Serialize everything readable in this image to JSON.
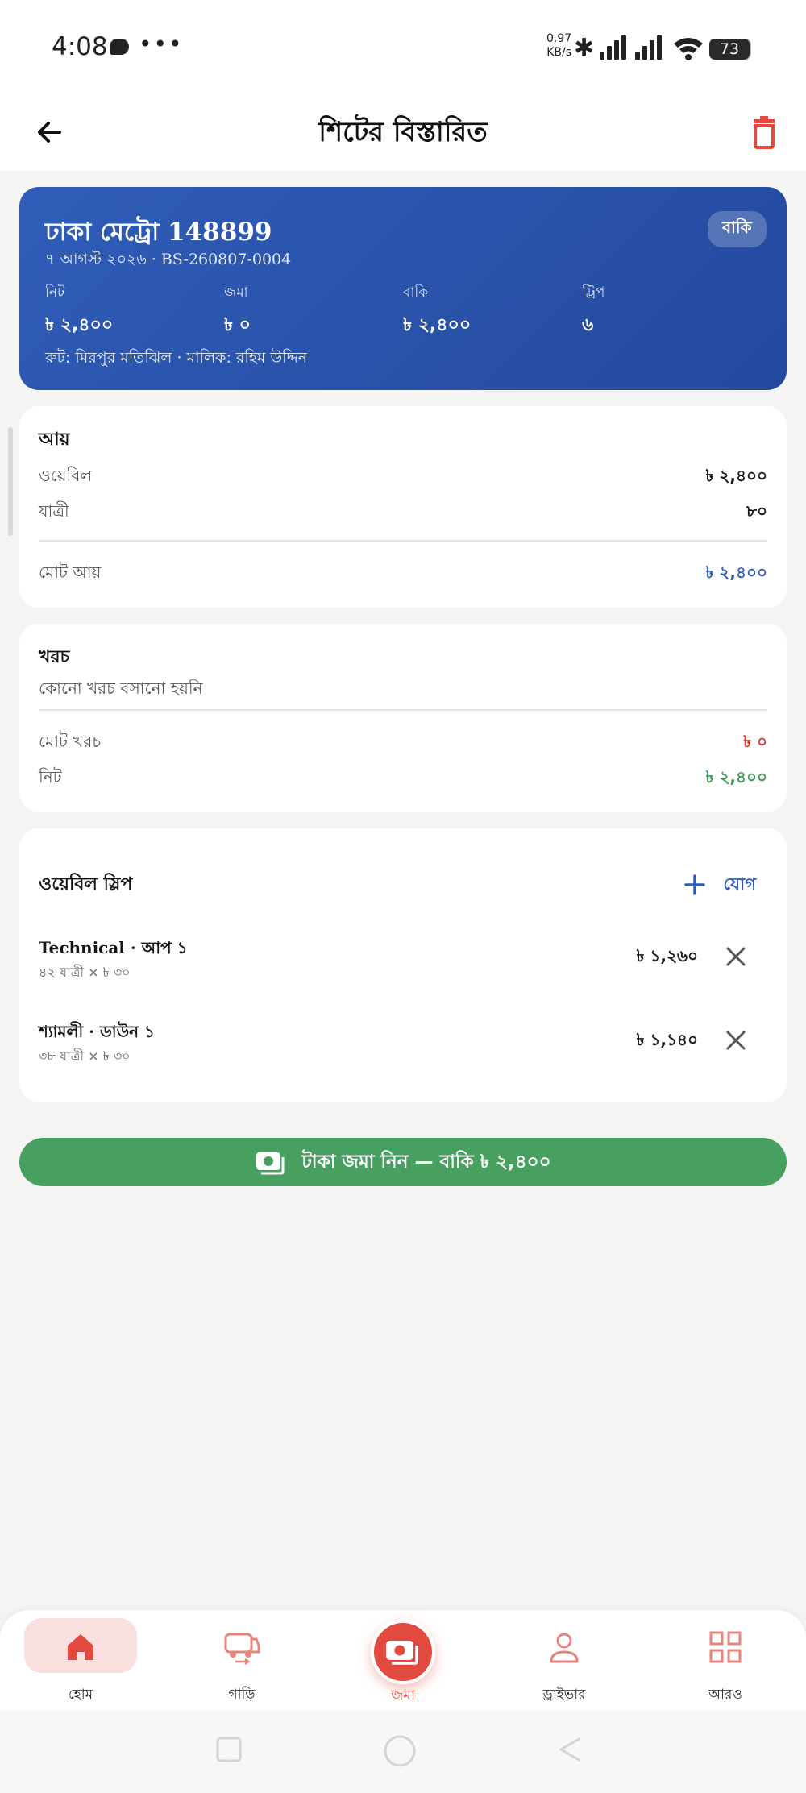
{
  "status_bar": {
    "time": "4:08",
    "speed_value": "0.97",
    "speed_unit": "KB/s",
    "battery": "73"
  },
  "app_bar": {
    "title": "শিটের বিস্তারিত"
  },
  "summary": {
    "title": "ঢাকা মেট্রো 148899",
    "subtitle": "৭ আগস্ট ২০২৬ · BS-260807-0004",
    "badge": "বাকি",
    "stats": [
      {
        "label": "নিট",
        "value": "৳ ২,৪০০"
      },
      {
        "label": "জমা",
        "value": "৳ ০"
      },
      {
        "label": "বাকি",
        "value": "৳ ২,৪০০"
      },
      {
        "label": "ট্রিপ",
        "value": "৬"
      }
    ],
    "route": "রুট: মিরপুর মতিঝিল · মালিক: রহিম উদ্দিন"
  },
  "income": {
    "heading": "আয়",
    "rows": [
      {
        "label": "ওয়েবিল",
        "value": "৳ ২,৪০০"
      },
      {
        "label": "যাত্রী",
        "value": "৮০"
      }
    ],
    "total_label": "মোট আয়",
    "total_value": "৳ ২,৪০০"
  },
  "expense": {
    "heading": "খরচ",
    "empty_text": "কোনো খরচ বসানো হয়নি",
    "total_label": "মোট খরচ",
    "total_value": "৳ ০",
    "net_label": "নিট",
    "net_value": "৳ ২,৪০০"
  },
  "waybill": {
    "heading": "ওয়েবিল স্লিপ",
    "add_label": "যোগ",
    "slips": [
      {
        "title": "Technical · আপ ১",
        "detail": "৪২ যাত্রী × ৳ ৩০",
        "amount": "৳ ১,২৬০"
      },
      {
        "title": "শ্যামলী · ডাউন ১",
        "detail": "৩৮ যাত্রী × ৳ ৩০",
        "amount": "৳ ১,১৪০"
      }
    ]
  },
  "action": {
    "label": "টাকা জমা নিন — বাকি ৳ ২,৪০০"
  },
  "bottom_nav": {
    "items": [
      {
        "label": "হোম",
        "icon": "home-icon"
      },
      {
        "label": "গাড়ি",
        "icon": "bus-icon"
      },
      {
        "label": "জমা",
        "icon": "cash-icon"
      },
      {
        "label": "ড্রাইভার",
        "icon": "person-icon"
      },
      {
        "label": "আরও",
        "icon": "grid-icon"
      }
    ]
  },
  "colors": {
    "primary_blue": "#2f5db8",
    "accent_red": "#e24a3f",
    "success_green": "#47a05f",
    "expense_red": "#d23b32",
    "net_green": "#3e9a57"
  }
}
